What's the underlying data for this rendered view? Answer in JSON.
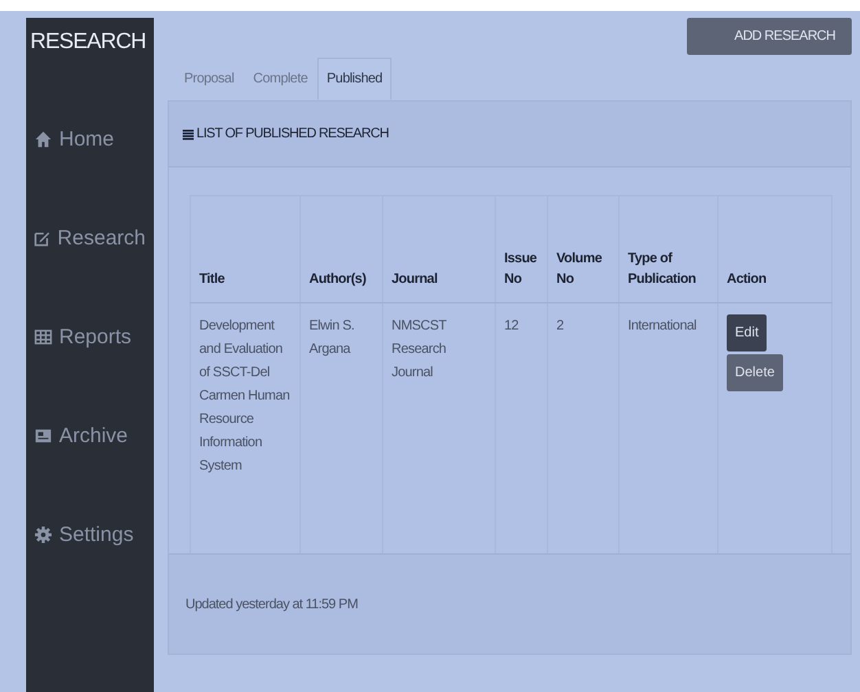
{
  "brand": "RESEARCH",
  "sidebar": {
    "items": [
      {
        "label": "Home"
      },
      {
        "label": "Research"
      },
      {
        "label": "Reports"
      },
      {
        "label": "Archive"
      },
      {
        "label": "Settings"
      }
    ]
  },
  "add_button": "ADD RESEARCH",
  "tabs": [
    {
      "label": "Proposal",
      "selected": false
    },
    {
      "label": "Complete",
      "selected": false
    },
    {
      "label": "Published",
      "selected": true
    }
  ],
  "panel": {
    "title": "LIST OF PUBLISHED RESEARCH",
    "footer": "Updated yesterday at 11:59 PM"
  },
  "table": {
    "columns": [
      "Title",
      "Author(s)",
      "Journal",
      "Issue No",
      "Volume No",
      "Type of Publication",
      "Action"
    ],
    "rows": [
      {
        "cells": [
          "Development and Evaluation of SSCT-Del Carmen Human Resource Information System",
          "Elwin S. Argana",
          "NMSCST Research Journal",
          "12",
          "2",
          "International"
        ],
        "actions": [
          {
            "label": "Edit",
            "kind": "primary"
          },
          {
            "label": "Delete",
            "kind": "danger"
          }
        ]
      }
    ]
  }
}
